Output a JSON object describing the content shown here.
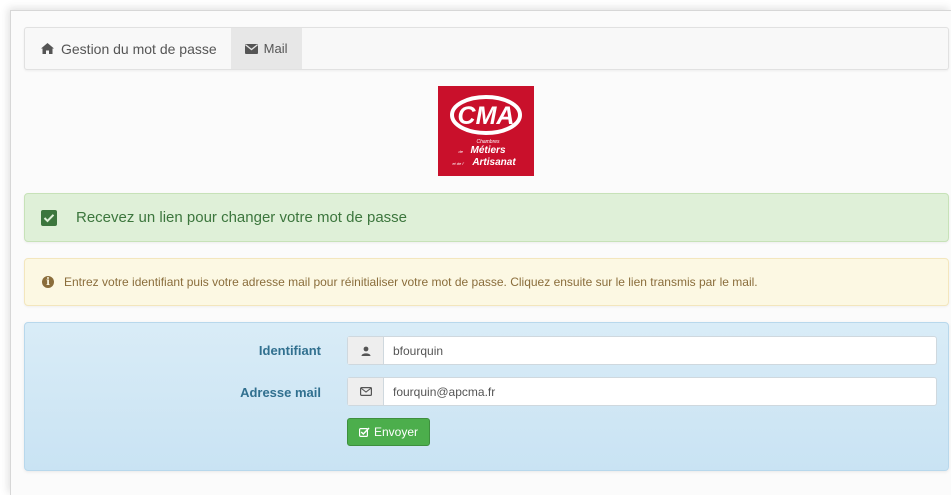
{
  "nav": {
    "tabs": [
      {
        "label": "Gestion du mot de passe",
        "icon": "home-icon"
      },
      {
        "label": "Mail",
        "icon": "envelope-icon",
        "active": true
      }
    ]
  },
  "logo": {
    "brand": "CMA",
    "line1": "Chambres",
    "line2": "Métiers",
    "line3": "Artisanat",
    "prefix2": "de",
    "prefix3": "et de l'"
  },
  "alerts": {
    "success": "Recevez un lien pour changer votre mot de passe",
    "warning": "Entrez votre identifiant puis votre adresse mail pour réinitialiser votre mot de passe. Cliquez ensuite sur le lien transmis par le mail."
  },
  "form": {
    "identifiant_label": "Identifiant",
    "identifiant_value": "bfourquin",
    "email_label": "Adresse mail",
    "email_value": "fourquin@apcma.fr",
    "submit_label": "Envoyer"
  },
  "colors": {
    "brand_red": "#c9102b",
    "success_bg": "#dff0d8",
    "warning_bg": "#fcf8e3",
    "panel_bg": "#d2e8f5",
    "button_green": "#4cae4c"
  }
}
